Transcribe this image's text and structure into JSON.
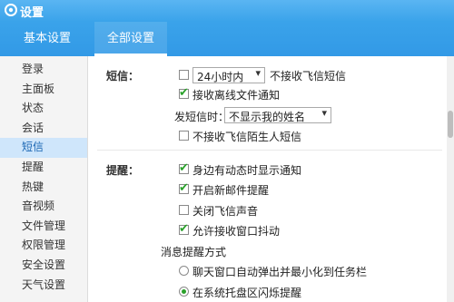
{
  "window": {
    "title": "设置",
    "minimize_icon": "minimize-icon",
    "close_icon": "close-icon"
  },
  "tabs": [
    {
      "label": "基本设置"
    },
    {
      "label": "全部设置"
    }
  ],
  "sidebar": {
    "items": [
      {
        "label": "登录"
      },
      {
        "label": "主面板"
      },
      {
        "label": "状态"
      },
      {
        "label": "会话"
      },
      {
        "label": "短信"
      },
      {
        "label": "提醒"
      },
      {
        "label": "热键"
      },
      {
        "label": "音视频"
      },
      {
        "label": "文件管理"
      },
      {
        "label": "权限管理"
      },
      {
        "label": "安全设置"
      },
      {
        "label": "天气设置"
      }
    ],
    "selected": "短信"
  },
  "sms": {
    "section_label": "短信：",
    "time_select_value": "24小时内",
    "no_receive_label": "不接收飞信短信",
    "offline_file_label": "接收离线文件通知",
    "send_as_label": "发短信时：",
    "send_as_value": "不显示我的姓名",
    "no_stranger_label": "不接收飞信陌生人短信"
  },
  "reminder": {
    "section_label": "提醒：",
    "friend_update_label": "身边有动态时显示通知",
    "new_mail_label": "开启新邮件提醒",
    "mute_label": "关闭飞信声音",
    "shake_label": "允许接收窗口抖动",
    "msg_method_label": "消息提醒方式",
    "popup_label": "聊天窗口自动弹出并最小化到任务栏",
    "tray_flash_label": "在系统托盘区闪烁提醒"
  }
}
